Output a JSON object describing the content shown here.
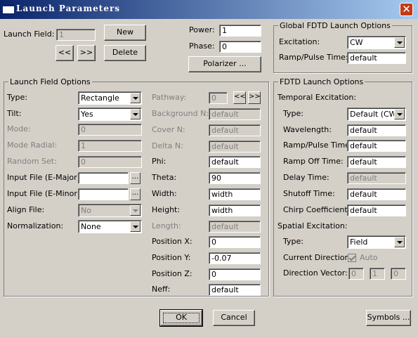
{
  "window": {
    "title": "Launch Parameters",
    "close_glyph": "✕"
  },
  "launch_field": {
    "label": "Launch Field:",
    "value": "1",
    "new_label": "New",
    "delete_label": "Delete",
    "prev_label": "<<",
    "next_label": ">>"
  },
  "power": {
    "label": "Power:",
    "value": "1"
  },
  "phase": {
    "label": "Phase:",
    "value": "0"
  },
  "polarizer_label": "Polarizer ...",
  "global": {
    "legend": "Global FDTD Launch Options",
    "excitation_label": "Excitation:",
    "excitation_value": "CW",
    "ramp_label": "Ramp/Pulse Time:",
    "ramp_value": "default"
  },
  "lfo": {
    "legend": "Launch Field Options",
    "type_label": "Type:",
    "type_value": "Rectangle",
    "tilt_label": "Tilt:",
    "tilt_value": "Yes",
    "mode_label": "Mode:",
    "mode_value": "0",
    "mode_radial_label": "Mode Radial:",
    "mode_radial_value": "1",
    "random_set_label": "Random Set:",
    "random_set_value": "0",
    "input_major_label": "Input File (E-Major):",
    "input_major_value": "",
    "input_minor_label": "Input File (E-Minor):",
    "input_minor_value": "",
    "browse_label": "...",
    "align_label": "Align File:",
    "align_value": "No",
    "norm_label": "Normalization:",
    "norm_value": "None",
    "pathway_label": "Pathway:",
    "pathway_value": "0",
    "bg_label": "Background N:",
    "bg_value": "default",
    "cover_label": "Cover N:",
    "cover_value": "default",
    "delta_label": "Delta N:",
    "delta_value": "default",
    "phi_label": "Phi:",
    "phi_value": "default",
    "theta_label": "Theta:",
    "theta_value": "90",
    "width_label": "Width:",
    "width_value": "width",
    "height_label": "Height:",
    "height_value": "width",
    "length_label": "Length:",
    "length_value": "default",
    "posx_label": "Position X:",
    "posx_value": "0",
    "posy_label": "Position Y:",
    "posy_value": "-0.07",
    "posz_label": "Position Z:",
    "posz_value": "0",
    "neff_label": "Neff:",
    "neff_value": "default"
  },
  "fdtd": {
    "legend": "FDTD Launch Options",
    "temporal_label": "Temporal Excitation:",
    "ttype_label": "Type:",
    "ttype_value": "Default (CW)",
    "wavelength_label": "Wavelength:",
    "wavelength_value": "default",
    "ramp_label": "Ramp/Pulse Time:",
    "ramp_value": "default",
    "rampoff_label": "Ramp Off Time:",
    "rampoff_value": "default",
    "delay_label": "Delay Time:",
    "delay_value": "default",
    "shutoff_label": "Shutoff Time:",
    "shutoff_value": "default",
    "chirp_label": "Chirp Coefficient:",
    "chirp_value": "default",
    "spatial_label": "Spatial Excitation:",
    "stype_label": "Type:",
    "stype_value": "Field",
    "curdir_label": "Current Direction:",
    "auto_label": "Auto",
    "dirvec_label": "Direction Vector:",
    "dirvec_x": "0",
    "dirvec_y": "1",
    "dirvec_z": "0"
  },
  "footer": {
    "ok_label": "OK",
    "cancel_label": "Cancel",
    "symbols_label": "Symbols ..."
  }
}
